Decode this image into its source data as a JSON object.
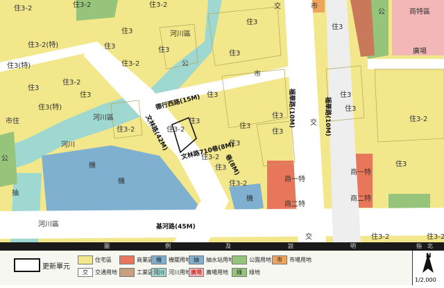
{
  "map": {
    "zone_labels": {
      "residential_3": "住3",
      "residential_3_2": "住3-2",
      "residential_3_2_special": "住3-2(特)",
      "residential_3_special": "住3(特)",
      "commercial_residential": "市住",
      "park": "公",
      "river": "河川",
      "river_zone": "河川區",
      "organ": "機",
      "square": "廣場",
      "market": "市",
      "commercial_1": "商一特",
      "commercial_2": "商二特",
      "commercial_1b": "商一特",
      "commercial_2b": "商二特",
      "traffic": "交",
      "pump": "抽",
      "special_commercial": "商特區"
    },
    "road_labels": {
      "wenlin_road": "文林路(42M)",
      "jihe_road": "基河路(45M)",
      "fuhua_road": "福華路(10M)",
      "fuhua_road2": "福華路(10M)",
      "dexing_west_road": "德行西路(15M)",
      "wenlin_small": "文林路710巷(8M)",
      "lane_8m": "巷(8M)"
    }
  },
  "legend": {
    "header": {
      "col1": "圖",
      "col2": "例",
      "col3": "及",
      "col4": "說",
      "col5": "明",
      "north_header": "指　北"
    },
    "update_unit": "更新單元",
    "items": [
      {
        "symbol": "",
        "label": "住宅區",
        "color": "#f2e78a"
      },
      {
        "symbol": "",
        "label": "商業區",
        "color": "#e8765a"
      },
      {
        "symbol": "",
        "label": "工業區",
        "color": "#c9a07e"
      },
      {
        "symbol": "機",
        "label": "機關用地",
        "color": "#7fb0cf"
      },
      {
        "symbol": "抽",
        "label": "抽水站用地",
        "color": "#7fb0cf"
      },
      {
        "symbol": "",
        "label": "公園用地",
        "color": "#95c47a"
      },
      {
        "symbol": "市",
        "label": "市場用地",
        "color": "#f0a35a"
      },
      {
        "symbol": "交",
        "label": "交通用地",
        "color": "#ffffff"
      },
      {
        "symbol": "河川",
        "label": "河川用地",
        "color": "#9fd8d0"
      },
      {
        "symbol": "廣場",
        "label": "廣場用地",
        "color": "#f3b7b7"
      },
      {
        "symbol": "綠",
        "label": "綠地",
        "color": "#95c47a"
      }
    ],
    "north_letter": "N",
    "scale": "1/2,000"
  }
}
